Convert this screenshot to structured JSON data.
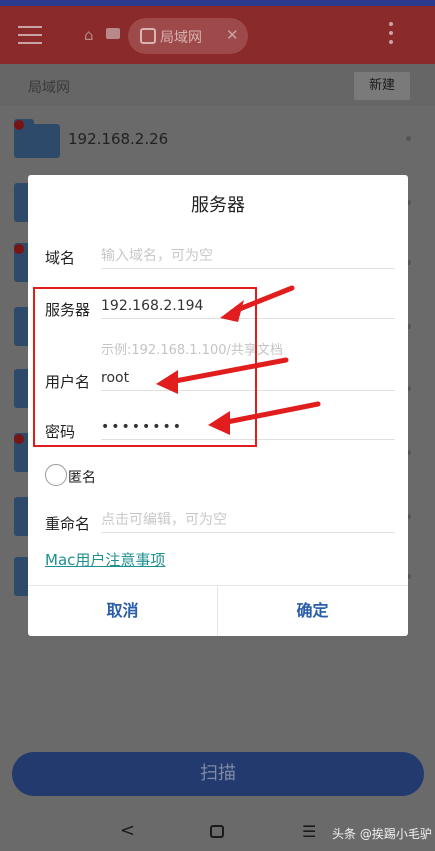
{
  "header": {
    "tab_label": "局域网",
    "tab_close": "✕"
  },
  "breadcrumb": "局域网",
  "new_button": "新建",
  "files": [
    {
      "name": "192.168.2.26"
    }
  ],
  "scan_button": "扫描",
  "dialog": {
    "title": "服务器",
    "domain": {
      "label": "域名",
      "placeholder": "输入域名，可为空"
    },
    "server": {
      "label": "服务器",
      "value": "192.168.2.194",
      "hint": "示例:192.168.1.100/共享文档"
    },
    "username": {
      "label": "用户名",
      "value": "root"
    },
    "password": {
      "label": "密码",
      "value": "••••••••"
    },
    "anonymous": {
      "label": "匿名"
    },
    "rename": {
      "label": "重命名",
      "placeholder": "点击可编辑，可为空"
    },
    "mac_link": "Mac用户注意事项",
    "cancel": "取消",
    "ok": "确定"
  },
  "nav": {
    "back": "<",
    "menu": "☰"
  },
  "watermark": "头条 @挨踢小毛驴",
  "colors": {
    "annotation": "#e21d1d",
    "link": "#1f8f8f",
    "button_text": "#2a5ea8"
  }
}
